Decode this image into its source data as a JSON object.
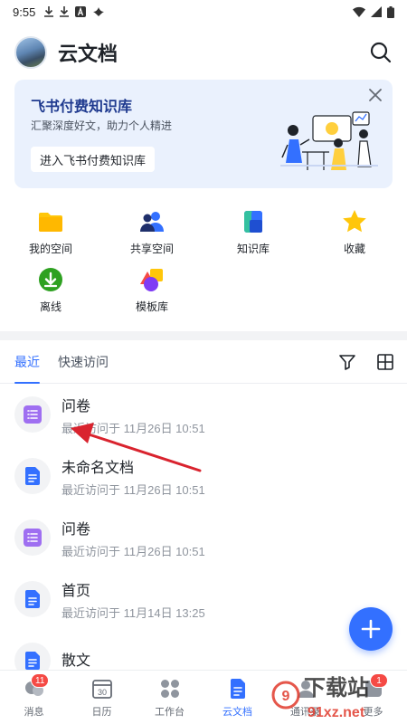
{
  "status_bar": {
    "time": "9:55"
  },
  "header": {
    "title": "云文档"
  },
  "promo": {
    "title": "飞书付费知识库",
    "subtitle": "汇聚深度好文，助力个人精进",
    "button": "进入飞书付费知识库"
  },
  "quick_access": [
    {
      "label": "我的空间",
      "icon": "folder-icon"
    },
    {
      "label": "共享空间",
      "icon": "shared-space-icon"
    },
    {
      "label": "知识库",
      "icon": "wiki-icon"
    },
    {
      "label": "收藏",
      "icon": "star-icon"
    },
    {
      "label": "离线",
      "icon": "offline-download-icon"
    },
    {
      "label": "模板库",
      "icon": "template-icon"
    }
  ],
  "tabs": [
    {
      "label": "最近",
      "active": true
    },
    {
      "label": "快速访问",
      "active": false
    }
  ],
  "documents": [
    {
      "name": "问卷",
      "time": "最近访问于 11月26日 10:51",
      "type": "survey"
    },
    {
      "name": "未命名文档",
      "time": "最近访问于 11月26日 10:51",
      "type": "doc"
    },
    {
      "name": "问卷",
      "time": "最近访问于 11月26日 10:51",
      "type": "survey"
    },
    {
      "name": "首页",
      "time": "最近访问于 11月14日 13:25",
      "type": "doc"
    },
    {
      "name": "散文",
      "time": "",
      "type": "doc"
    }
  ],
  "bottom_nav": [
    {
      "label": "消息",
      "badge": "11",
      "active": false
    },
    {
      "label": "日历",
      "icon_text": "30",
      "active": false
    },
    {
      "label": "工作台",
      "active": false
    },
    {
      "label": "云文档",
      "active": true
    },
    {
      "label": "通讯录",
      "active": false
    },
    {
      "label": "更多",
      "badge": "1",
      "active": false
    }
  ],
  "watermark": {
    "text1": "下载站",
    "text2": "91xz.net"
  },
  "colors": {
    "accent": "#3370ff",
    "survey": "#9f6ff1",
    "doc": "#3370ff",
    "badge": "#f54a45",
    "arrow": "#d9232e"
  }
}
